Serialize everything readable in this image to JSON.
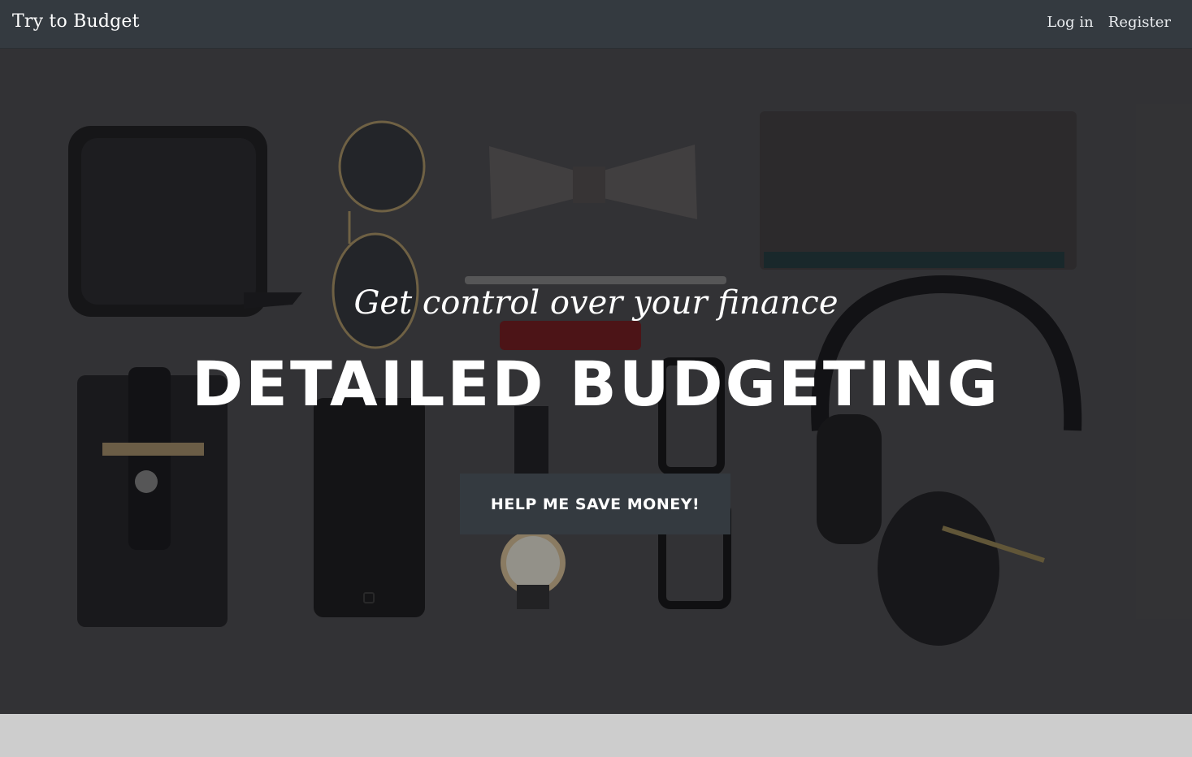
{
  "navbar": {
    "brand": "Try to Budget",
    "links": [
      {
        "label": "Log in"
      },
      {
        "label": "Register"
      }
    ]
  },
  "hero": {
    "subtitle": "Get control over your finance",
    "title": "DETAILED BUDGETING",
    "cta_label": "HELP ME SAVE MONEY!",
    "background_description_icons": [
      "wallet",
      "sunglasses",
      "bow-tie",
      "notebook",
      "pen",
      "lipstick",
      "card-holder",
      "smartphone",
      "watch",
      "glasses",
      "headphones"
    ]
  },
  "colors": {
    "navbar_bg": "#343a40",
    "hero_bg": "#3f3f41",
    "cta_bg": "#343a40",
    "page_bg": "#cdcdcd",
    "text": "#ffffff"
  }
}
